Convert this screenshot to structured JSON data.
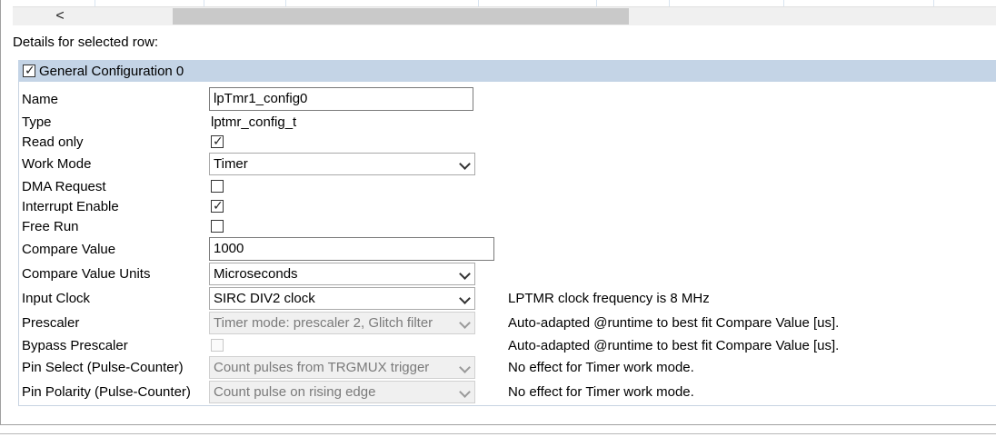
{
  "scrollbar": {
    "left_arrow": "<"
  },
  "details_label": "Details for selected row:",
  "group": {
    "title": "General Configuration 0",
    "checked": true
  },
  "fields": {
    "name": {
      "label": "Name",
      "value": "lpTmr1_config0"
    },
    "type": {
      "label": "Type",
      "value": "lptmr_config_t"
    },
    "read_only": {
      "label": "Read only",
      "checked": true
    },
    "work_mode": {
      "label": "Work Mode",
      "value": "Timer"
    },
    "dma_request": {
      "label": "DMA Request",
      "checked": false
    },
    "interrupt_enable": {
      "label": "Interrupt Enable",
      "checked": true
    },
    "free_run": {
      "label": "Free Run",
      "checked": false
    },
    "compare_value": {
      "label": "Compare Value",
      "value": "1000"
    },
    "compare_value_units": {
      "label": "Compare Value Units",
      "value": "Microseconds"
    },
    "input_clock": {
      "label": "Input Clock",
      "value": "SIRC DIV2 clock",
      "info": "LPTMR clock frequency is 8 MHz"
    },
    "prescaler": {
      "label": "Prescaler",
      "value": "Timer mode: prescaler 2, Glitch filter",
      "info": "Auto-adapted @runtime to best fit Compare Value [us].",
      "disabled": true
    },
    "bypass_prescaler": {
      "label": "Bypass Prescaler",
      "checked": false,
      "info": "Auto-adapted @runtime to best fit Compare Value [us].",
      "disabled": true
    },
    "pin_select": {
      "label": "Pin Select (Pulse-Counter)",
      "value": "Count pulses from TRGMUX trigger",
      "info": "No effect for Timer work mode.",
      "disabled": true
    },
    "pin_polarity": {
      "label": "Pin Polarity (Pulse-Counter)",
      "value": "Count pulse on rising edge",
      "info": "No effect for Timer work mode.",
      "disabled": true
    }
  },
  "check_glyph": "✓",
  "icons": {
    "checkbox": "checkbox-icon",
    "dropdown": "chevron-down-icon"
  },
  "colors": {
    "group_header_bg": "#c4d4e6",
    "scroll_thumb": "#c9c9c9"
  }
}
